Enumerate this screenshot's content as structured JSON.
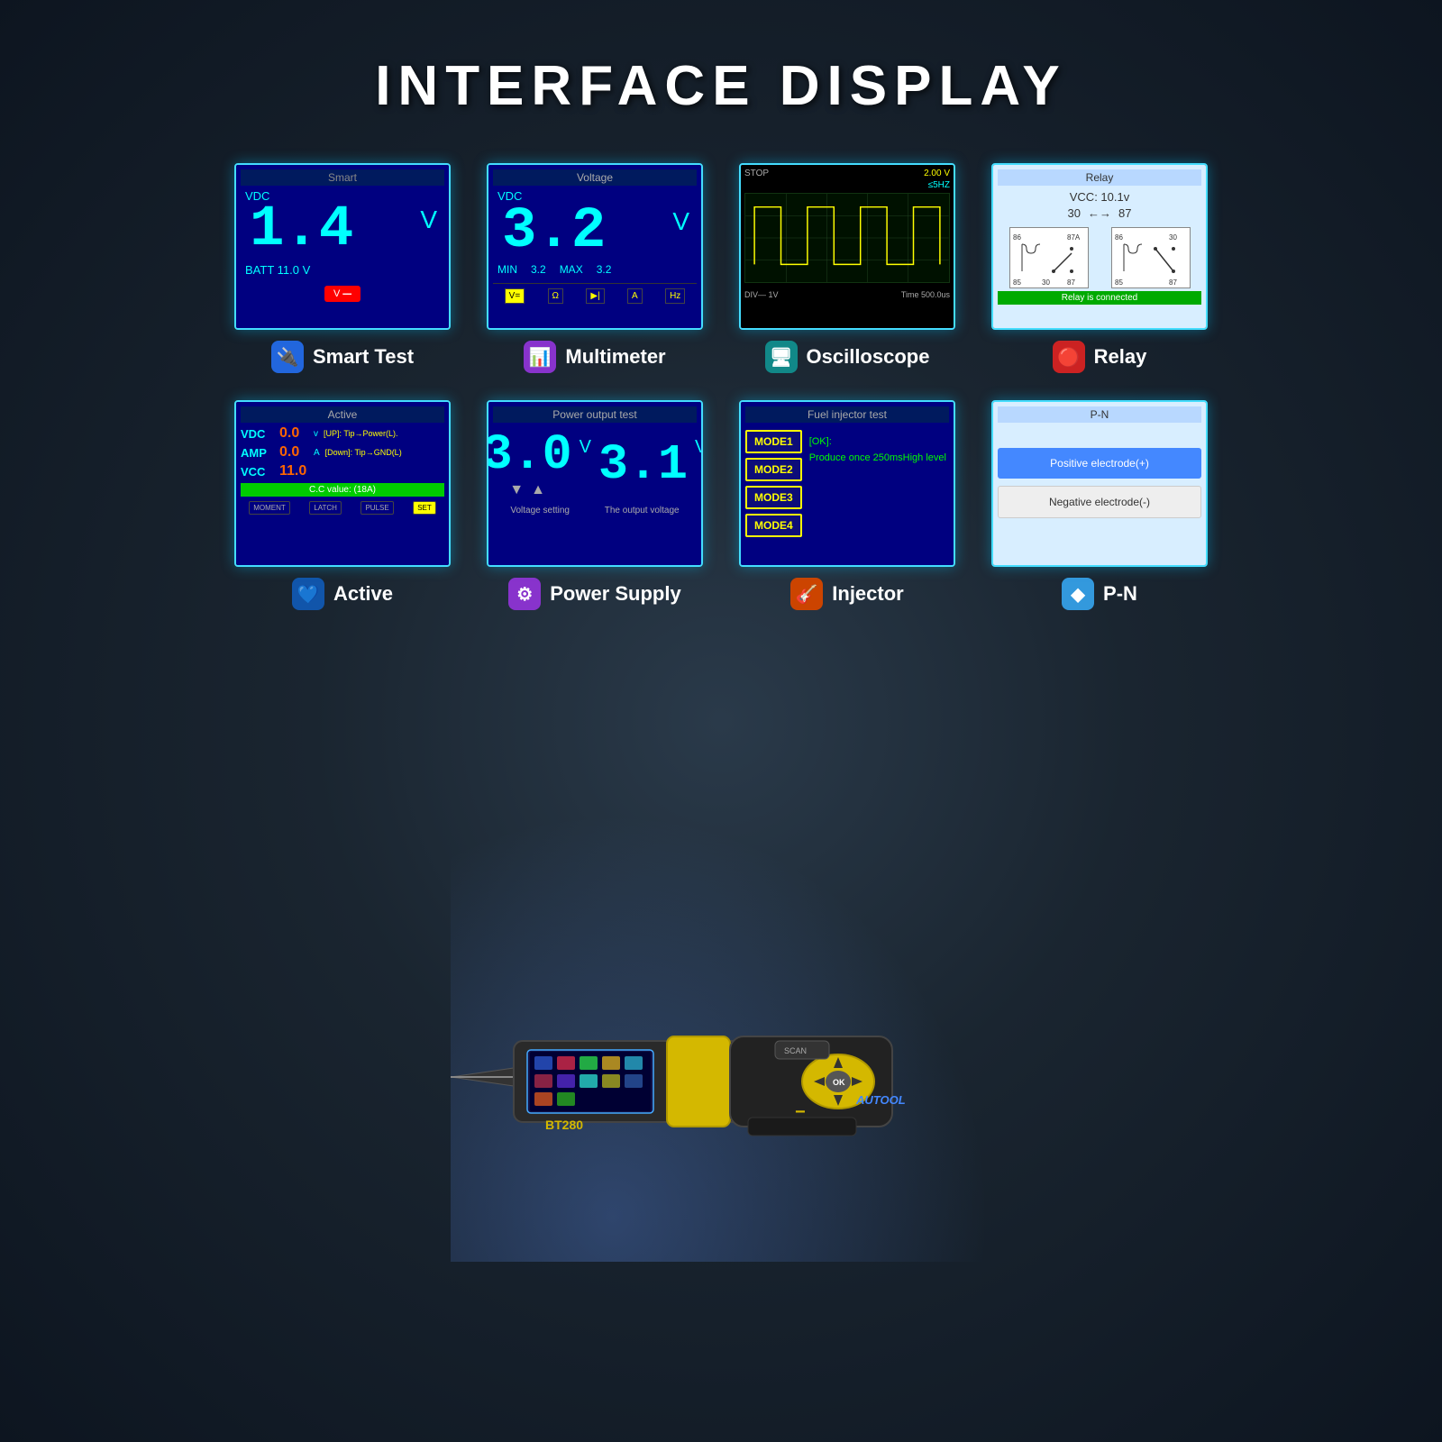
{
  "page": {
    "title": "INTERFACE DISPLAY",
    "background": "#1a2a3a"
  },
  "screens": {
    "smart": {
      "title": "Smart",
      "label": "Smart Test",
      "vdc": "VDC",
      "value": "1.4",
      "unit": "V",
      "batt": "BATT 11.0 V",
      "icon": "🔌"
    },
    "multimeter": {
      "title": "Voltage",
      "label": "Multimeter",
      "vdc": "VDC",
      "value": "3.2",
      "unit": "V",
      "min_label": "MIN",
      "min_val": "3.2",
      "max_label": "MAX",
      "max_val": "3.2",
      "funcs": [
        "V=",
        "Ω",
        "▶|◀",
        "A",
        "Hz"
      ],
      "icon": "📊"
    },
    "oscilloscope": {
      "title": "Oscilloscope",
      "label": "Oscilloscope",
      "stop": "STOP",
      "voltage": "2.00 V",
      "freq": "≤5HZ",
      "div": "DIV— 1V",
      "time": "Time 500.0us",
      "icon": "🖥"
    },
    "relay": {
      "title": "Relay",
      "label": "Relay",
      "vcc": "VCC: 10.1v",
      "pin_30": "30",
      "pin_87": "87",
      "status": "Relay is connected",
      "icon": "🔴"
    },
    "active": {
      "title": "Active",
      "label": "Active",
      "vdc": "VDC",
      "vdc_val": "0.0",
      "amp": "AMP",
      "amp_val": "0.0",
      "vcc": "VCC",
      "vcc_val": "11.0",
      "note_up": "[UP]: Tip→Power(L).",
      "note_down": "[Down]: Tip→GND(L)",
      "cc_label": "C.C value: (18A)",
      "modes": [
        "MOMENT",
        "LATCH",
        "PULSE",
        "SET"
      ],
      "icon": "💙"
    },
    "power": {
      "title": "Power output test",
      "label": "Power Supply",
      "voltage_set": "3.0",
      "voltage_out": "3.1",
      "unit": "V",
      "set_label": "Voltage setting",
      "out_label": "The output voltage",
      "icon": "⚙"
    },
    "injector": {
      "title": "Fuel injector test",
      "label": "Injector",
      "modes": [
        "MODE1",
        "MODE2",
        "MODE3",
        "MODE4"
      ],
      "ok_label": "[OK]:",
      "ok_desc": "Produce once 250msHigh level",
      "icon": "🎸"
    },
    "pn": {
      "title": "P-N",
      "label": "P-N",
      "positive": "Positive electrode(+)",
      "negative": "Negative electrode(-)",
      "icon": "◆"
    }
  },
  "device": {
    "model": "BT280",
    "brand": "AUTOOL"
  }
}
